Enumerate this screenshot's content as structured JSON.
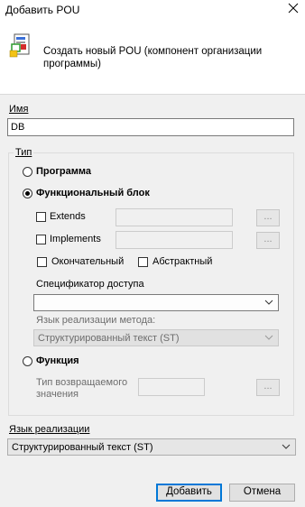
{
  "window": {
    "title": "Добавить POU"
  },
  "header": {
    "description": "Создать новый POU (компонент организации программы)"
  },
  "name": {
    "label": "Имя",
    "value": "DB"
  },
  "type_group": {
    "label": "Тип",
    "program_label": "Программа",
    "function_block_label": "Функциональный блок",
    "extends_label": "Extends",
    "implements_label": "Implements",
    "final_label": "Окончательный",
    "abstract_label": "Абстрактный",
    "access_specifier_label": "Спецификатор доступа",
    "method_language_label": "Язык реализации метода:",
    "method_language_value": "Структурированный текст (ST)",
    "function_label": "Функция",
    "return_type_label": "Тип возвращаемого значения",
    "dots_label": "...",
    "selected": "function_block"
  },
  "impl_language": {
    "label": "Язык реализации",
    "value": "Структурированный текст (ST)"
  },
  "buttons": {
    "add_label": "Добавить",
    "cancel_label": "Отмена"
  },
  "icons": [
    "close-icon",
    "document-pou-icon",
    "chevron-down-icon"
  ],
  "colors": {
    "accent": "#0078d7",
    "panel": "#f0f0f0"
  }
}
